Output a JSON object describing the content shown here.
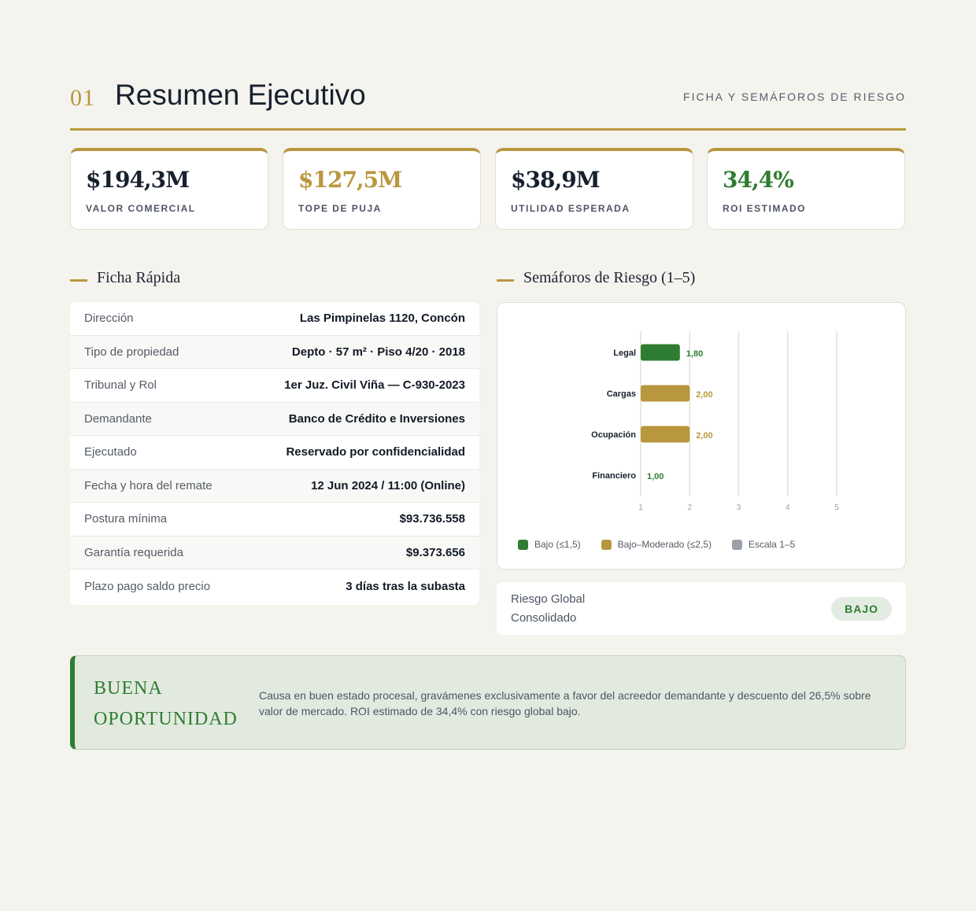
{
  "header": {
    "number": "01",
    "title": "Resumen Ejecutivo",
    "subtitle": "FICHA Y SEMÁFOROS DE RIESGO"
  },
  "kpis": [
    {
      "value": "$194,3M",
      "label": "VALOR COMERCIAL",
      "color": "#17202d"
    },
    {
      "value": "$127,5M",
      "label": "TOPE DE PUJA",
      "color": "#b9973f"
    },
    {
      "value": "$38,9M",
      "label": "UTILIDAD ESPERADA",
      "color": "#17202d"
    },
    {
      "value": "34,4%",
      "label": "ROI ESTIMADO",
      "color": "#2e7d32"
    }
  ],
  "ficha": {
    "title": "Ficha Rápida",
    "rows": [
      {
        "key": "Dirección",
        "value": "Las Pimpinelas 1120, Concón"
      },
      {
        "key": "Tipo de propiedad",
        "value": "Depto · 57 m² · Piso 4/20 · 2018"
      },
      {
        "key": "Tribunal y Rol",
        "value": "1er Juz. Civil Viña — C-930-2023"
      },
      {
        "key": "Demandante",
        "value": "Banco de Crédito e Inversiones"
      },
      {
        "key": "Ejecutado",
        "value": "Reservado por confidencialidad"
      },
      {
        "key": "Fecha y hora del remate",
        "value": "12 Jun 2024 / 11:00 (Online)"
      },
      {
        "key": "Postura mínima",
        "value": "$93.736.558"
      },
      {
        "key": "Garantía requerida",
        "value": "$9.373.656"
      },
      {
        "key": "Plazo pago saldo precio",
        "value": "3 días tras la subasta"
      }
    ]
  },
  "risk": {
    "title": "Semáforos de Riesgo (1–5)",
    "legend": [
      {
        "label": "Bajo (≤1,5)",
        "color": "#2e7d32"
      },
      {
        "label": "Bajo–Moderado (≤2,5)",
        "color": "#b9973f"
      },
      {
        "label": "Escala 1–5",
        "color": "#9aa0a8"
      }
    ],
    "global_label": "Riesgo Global Consolidado",
    "global_badge": "BAJO"
  },
  "chart_data": {
    "type": "bar",
    "orientation": "horizontal",
    "categories": [
      "Legal",
      "Cargas",
      "Ocupación",
      "Financiero"
    ],
    "values": [
      1.8,
      2.0,
      2.0,
      1.0
    ],
    "value_labels": [
      "1,80",
      "2,00",
      "2,00",
      "1,00"
    ],
    "colors": [
      "#2e7d32",
      "#b9973f",
      "#b9973f",
      "#2e7d32"
    ],
    "xlim": [
      1,
      5
    ],
    "xticks": [
      "1",
      "2",
      "3",
      "4",
      "5"
    ],
    "grid": true
  },
  "verdict": {
    "title": "BUENA OPORTUNIDAD",
    "text": "Causa en buen estado procesal, gravámenes exclusivamente a favor del acreedor demandante y descuento del 26,5% sobre valor de mercado. ROI estimado de 34,4% con riesgo global bajo."
  }
}
